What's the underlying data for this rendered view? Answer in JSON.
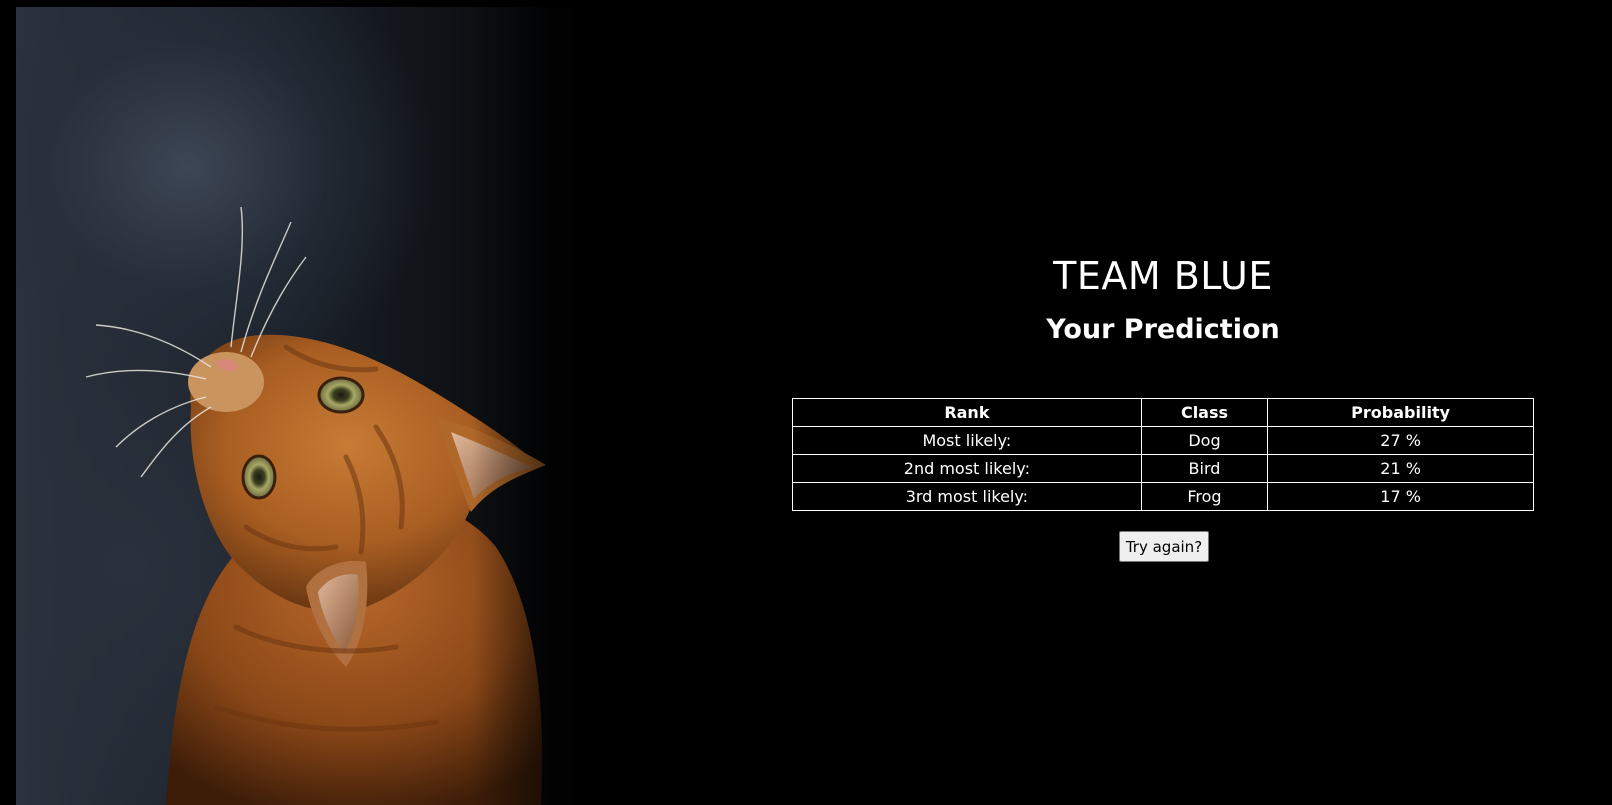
{
  "header": {
    "title": "TEAM BLUE",
    "subtitle": "Your Prediction"
  },
  "image": {
    "subject": "orange-tabby-cat-looking-up"
  },
  "table": {
    "columns": [
      "Rank",
      "Class",
      "Probability"
    ],
    "rows": [
      {
        "rank": "Most likely:",
        "class": "Dog",
        "probability": "27 %"
      },
      {
        "rank": "2nd most likely:",
        "class": "Bird",
        "probability": "21 %"
      },
      {
        "rank": "3rd most likely:",
        "class": "Frog",
        "probability": "17 %"
      }
    ]
  },
  "actions": {
    "try_again_label": "Try again?"
  },
  "colors": {
    "background": "#000000",
    "text": "#ffffff",
    "cat_fur": "#b5651d",
    "button_bg": "#efefef"
  }
}
